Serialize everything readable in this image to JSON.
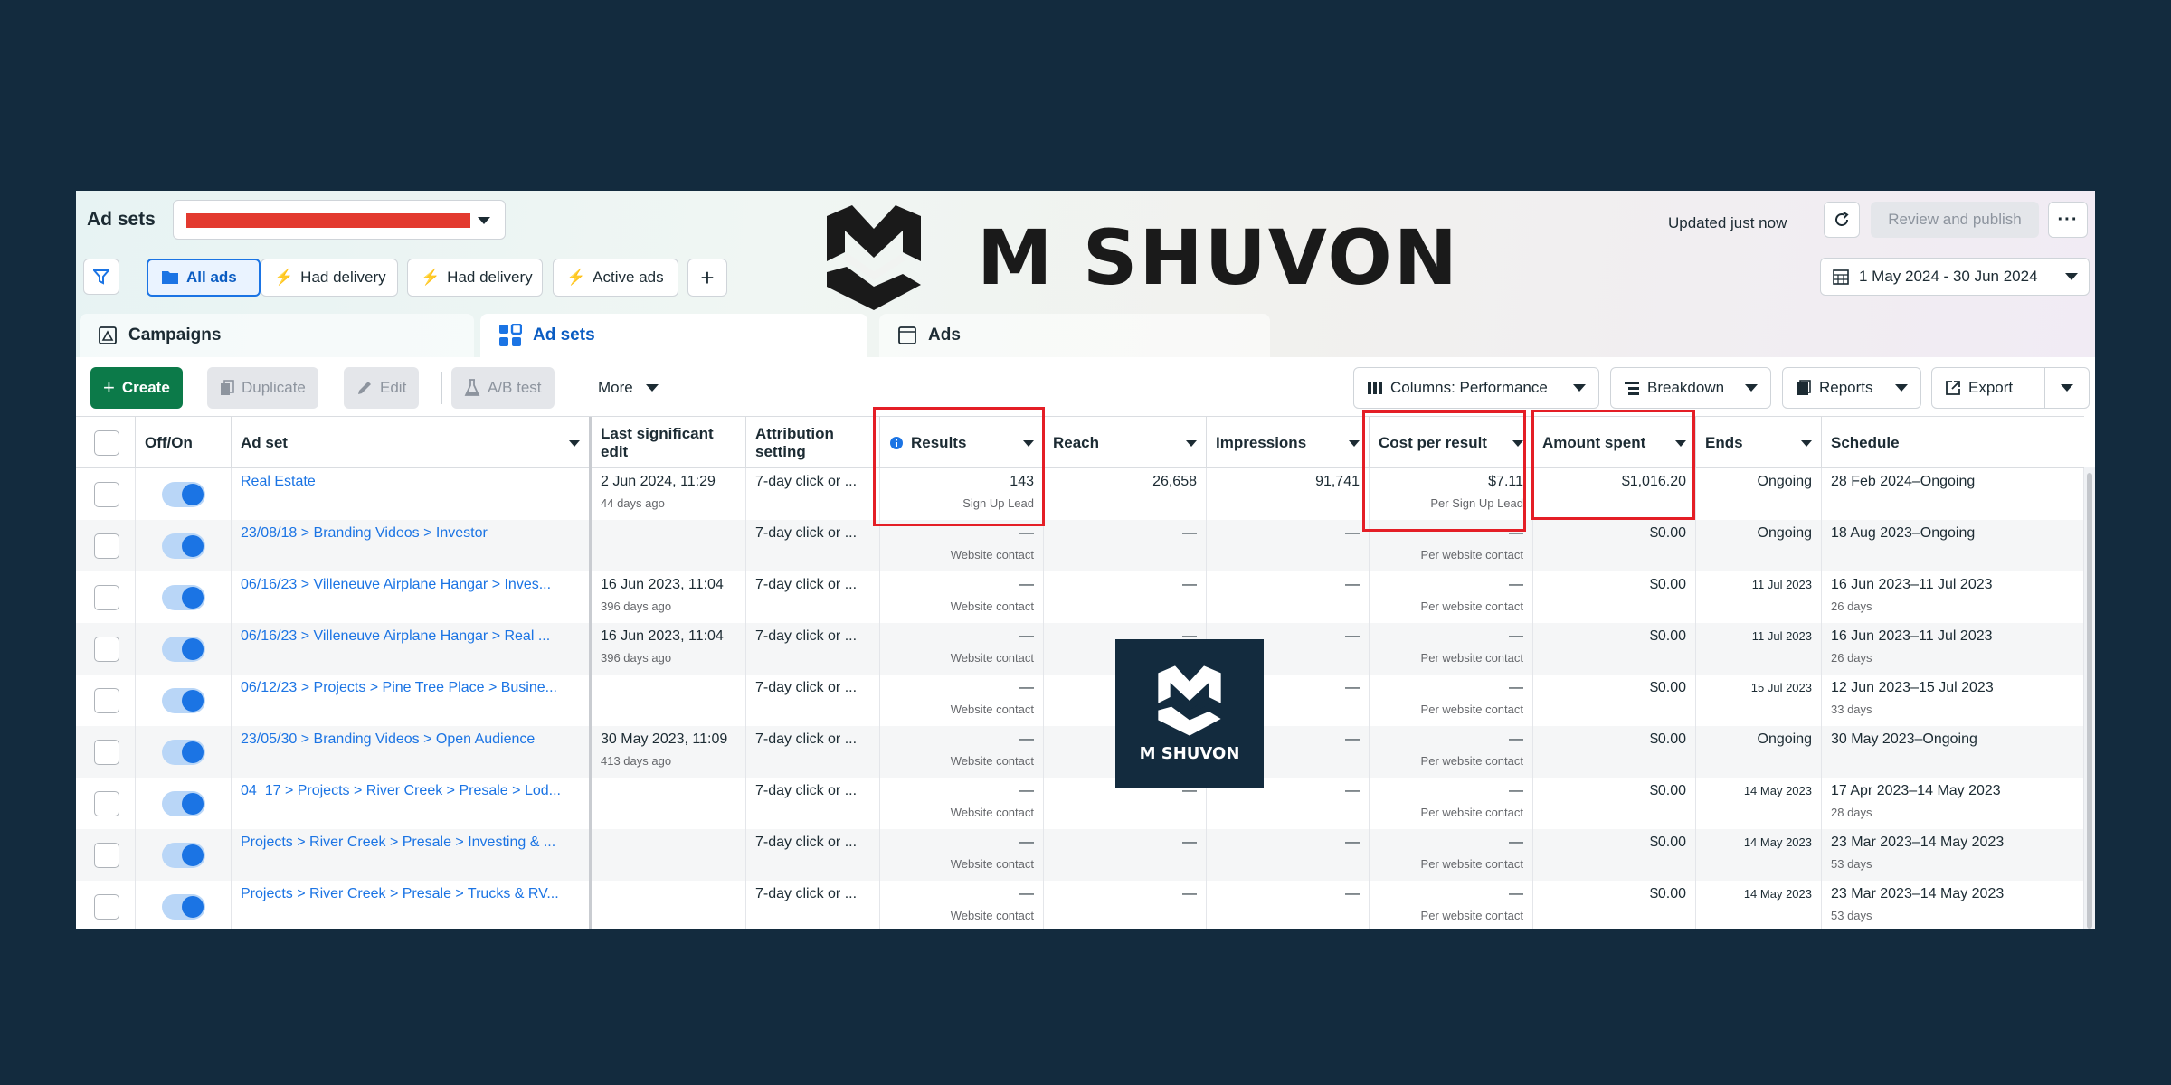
{
  "header": {
    "title": "Ad sets",
    "status": "Updated just now",
    "review_label": "Review and publish",
    "more_icon": "more-horizontal-icon",
    "date_range": "1 May 2024 - 30 Jun 2024"
  },
  "colors": {
    "background": "#132b3e",
    "accent": "#1b74e4",
    "create": "#0c7a49",
    "highlight": "#e41e26",
    "redaction": "#e33a2f"
  },
  "watermark": {
    "text": "M SHUVON"
  },
  "filters": {
    "all_ads": "All ads",
    "had_delivery_1": "Had delivery",
    "had_delivery_2": "Had delivery",
    "active_ads": "Active ads",
    "add": "+"
  },
  "tabs": {
    "campaigns": "Campaigns",
    "ad_sets": "Ad sets",
    "ads": "Ads"
  },
  "toolbar": {
    "create": "Create",
    "duplicate": "Duplicate",
    "edit": "Edit",
    "ab_test": "A/B test",
    "more": "More",
    "columns": "Columns: Performance",
    "breakdown": "Breakdown",
    "reports": "Reports",
    "export": "Export"
  },
  "table": {
    "headers": {
      "offon": "Off/On",
      "adset": "Ad set",
      "last_edit": "Last significant edit",
      "attribution": "Attribution setting",
      "results": "Results",
      "reach": "Reach",
      "impressions": "Impressions",
      "cost": "Cost per result",
      "spent": "Amount spent",
      "ends": "Ends",
      "schedule": "Schedule"
    },
    "rows": [
      {
        "name": "Real Estate",
        "edit": "2 Jun 2024, 11:29",
        "edit_sub": "44 days ago",
        "attr": "7-day click or ...",
        "results": "143",
        "results_sub": "Sign Up Lead",
        "reach": "26,658",
        "impr": "91,741",
        "cost": "$7.11",
        "cost_sub": "Per Sign Up Lead",
        "spent": "$1,016.20",
        "ends": "Ongoing",
        "sched": "28 Feb 2024–Ongoing",
        "sched_sub": ""
      },
      {
        "name": "23/08/18 > Branding Videos > Investor",
        "edit": "",
        "edit_sub": "",
        "attr": "7-day click or ...",
        "results": "—",
        "results_sub": "Website contact",
        "reach": "—",
        "impr": "—",
        "cost": "—",
        "cost_sub": "Per website contact",
        "spent": "$0.00",
        "ends": "Ongoing",
        "sched": "18 Aug 2023–Ongoing",
        "sched_sub": ""
      },
      {
        "name": "06/16/23 > Villeneuve Airplane Hangar > Inves...",
        "edit": "16 Jun 2023, 11:04",
        "edit_sub": "396 days ago",
        "attr": "7-day click or ...",
        "results": "—",
        "results_sub": "Website contact",
        "reach": "—",
        "impr": "—",
        "cost": "—",
        "cost_sub": "Per website contact",
        "spent": "$0.00",
        "ends": "11 Jul 2023",
        "sched": "16 Jun 2023–11 Jul 2023",
        "sched_sub": "26 days"
      },
      {
        "name": "06/16/23 > Villeneuve Airplane Hangar > Real ...",
        "edit": "16 Jun 2023, 11:04",
        "edit_sub": "396 days ago",
        "attr": "7-day click or ...",
        "results": "—",
        "results_sub": "Website contact",
        "reach": "—",
        "impr": "—",
        "cost": "—",
        "cost_sub": "Per website contact",
        "spent": "$0.00",
        "ends": "11 Jul 2023",
        "sched": "16 Jun 2023–11 Jul 2023",
        "sched_sub": "26 days"
      },
      {
        "name": "06/12/23 > Projects > Pine Tree Place > Busine...",
        "edit": "",
        "edit_sub": "",
        "attr": "7-day click or ...",
        "results": "—",
        "results_sub": "Website contact",
        "reach": "—",
        "impr": "—",
        "cost": "—",
        "cost_sub": "Per website contact",
        "spent": "$0.00",
        "ends": "15 Jul 2023",
        "sched": "12 Jun 2023–15 Jul 2023",
        "sched_sub": "33 days"
      },
      {
        "name": "23/05/30 > Branding Videos > Open Audience",
        "edit": "30 May 2023, 11:09",
        "edit_sub": "413 days ago",
        "attr": "7-day click or ...",
        "results": "—",
        "results_sub": "Website contact",
        "reach": "—",
        "impr": "—",
        "cost": "—",
        "cost_sub": "Per website contact",
        "spent": "$0.00",
        "ends": "Ongoing",
        "sched": "30 May 2023–Ongoing",
        "sched_sub": ""
      },
      {
        "name": "04_17 > Projects > River Creek > Presale > Lod...",
        "edit": "",
        "edit_sub": "",
        "attr": "7-day click or ...",
        "results": "—",
        "results_sub": "Website contact",
        "reach": "—",
        "impr": "—",
        "cost": "—",
        "cost_sub": "Per website contact",
        "spent": "$0.00",
        "ends": "14 May 2023",
        "sched": "17 Apr 2023–14 May 2023",
        "sched_sub": "28 days"
      },
      {
        "name": "Projects > River Creek > Presale > Investing & ...",
        "edit": "",
        "edit_sub": "",
        "attr": "7-day click or ...",
        "results": "—",
        "results_sub": "Website contact",
        "reach": "—",
        "impr": "—",
        "cost": "—",
        "cost_sub": "Per website contact",
        "spent": "$0.00",
        "ends": "14 May 2023",
        "sched": "23 Mar 2023–14 May 2023",
        "sched_sub": "53 days"
      },
      {
        "name": "Projects > River Creek > Presale > Trucks & RV...",
        "edit": "",
        "edit_sub": "",
        "attr": "7-day click or ...",
        "results": "—",
        "results_sub": "Website contact",
        "reach": "—",
        "impr": "—",
        "cost": "—",
        "cost_sub": "Per website contact",
        "spent": "$0.00",
        "ends": "14 May 2023",
        "sched": "23 Mar 2023–14 May 2023",
        "sched_sub": "53 days"
      }
    ]
  }
}
